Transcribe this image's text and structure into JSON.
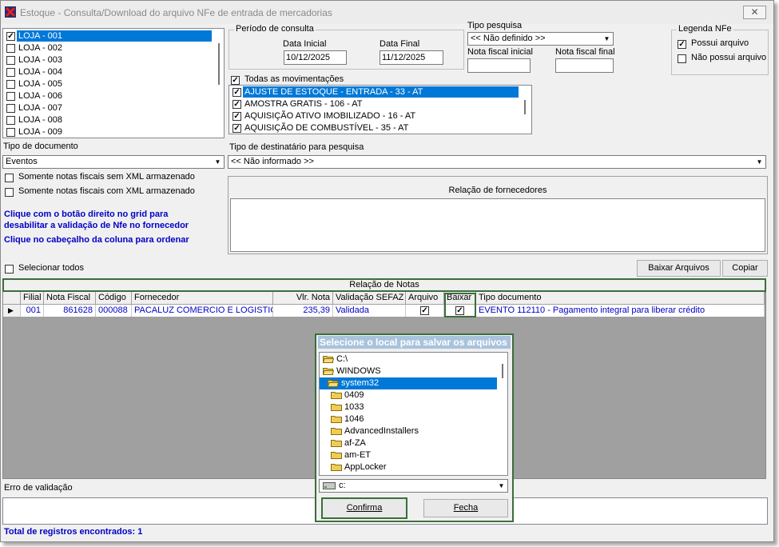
{
  "window": {
    "title": "Estoque - Consulta/Download do arquivo NFe de entrada de mercadorias",
    "close_label": "✕"
  },
  "stores": {
    "items": [
      {
        "label": "LOJA - 001",
        "checked": true,
        "selected": true
      },
      {
        "label": "LOJA - 002",
        "checked": false
      },
      {
        "label": "LOJA - 003",
        "checked": false
      },
      {
        "label": "LOJA - 004",
        "checked": false
      },
      {
        "label": "LOJA - 005",
        "checked": false
      },
      {
        "label": "LOJA - 006",
        "checked": false
      },
      {
        "label": "LOJA - 007",
        "checked": false
      },
      {
        "label": "LOJA - 008",
        "checked": false
      },
      {
        "label": "LOJA - 009",
        "checked": false
      }
    ]
  },
  "period": {
    "group_label": "Período de consulta",
    "start_label": "Data Inicial",
    "start_value": "10/12/2025",
    "end_label": "Data Final",
    "end_value": "11/12/2025"
  },
  "search_type": {
    "label": "Tipo pesquisa",
    "value": "<< Não definido >>"
  },
  "invoice_range": {
    "start_label": "Nota fiscal inicial",
    "end_label": "Nota fiscal final"
  },
  "legend": {
    "group_label": "Legenda NFe",
    "has_file": "Possui arquivo",
    "no_file": "Não possui arquivo"
  },
  "movements": {
    "all_label": "Todas as movimentações",
    "items": [
      {
        "label": "AJUSTE DE ESTOQUE - ENTRADA - 33 - AT",
        "selected": true
      },
      {
        "label": "AMOSTRA GRATIS - 106 - AT"
      },
      {
        "label": "AQUISIÇÃO ATIVO IMOBILIZADO - 16 - AT"
      },
      {
        "label": "AQUISIÇÃO DE COMBUSTÍVEL - 35 - AT"
      }
    ]
  },
  "doc_type": {
    "label": "Tipo de documento",
    "value": "Eventos"
  },
  "recipient_type": {
    "label": "Tipo de destinatário para pesquisa",
    "value": "<< Não informado >>"
  },
  "filters": {
    "without_xml": "Somente notas fiscais sem XML armazenado",
    "with_xml": "Somente notas fiscais com XML armazenado"
  },
  "hints": {
    "line1": "Clique com o botão direito no grid para",
    "line2": "desabilitar a validação de Nfe no fornecedor",
    "line3": "Clique no cabeçalho da coluna para ordenar"
  },
  "suppliers": {
    "header": "Relação de fornecedores"
  },
  "select_all_label": "Selecionar todos",
  "buttons": {
    "download": "Baixar Arquivos",
    "copy": "Copiar"
  },
  "notes": {
    "header": "Relação de Notas",
    "columns": [
      "Filial",
      "Nota Fiscal",
      "Código",
      "Fornecedor",
      "Vlr. Nota",
      "Validação SEFAZ",
      "Arquivo",
      "Baixar",
      "Tipo documento"
    ],
    "rows": [
      {
        "filial": "001",
        "nota": "861628",
        "codigo": "000088",
        "fornecedor": "PACALUZ COMERCIO E LOGISTIC",
        "valor": "235,39",
        "validacao": "Validada",
        "arquivo": true,
        "baixar": true,
        "tipo": "EVENTO 112110 - Pagamento integral para liberar crédito"
      }
    ]
  },
  "dialog": {
    "title": "Selecione o local para salvar os arquivos",
    "tree": [
      {
        "label": "C:\\",
        "level": 0,
        "open": true
      },
      {
        "label": "WINDOWS",
        "level": 1,
        "open": true
      },
      {
        "label": "system32",
        "level": 2,
        "open": true,
        "selected": true
      },
      {
        "label": "0409",
        "level": 3
      },
      {
        "label": "1033",
        "level": 3
      },
      {
        "label": "1046",
        "level": 3
      },
      {
        "label": "AdvancedInstallers",
        "level": 3
      },
      {
        "label": "af-ZA",
        "level": 3
      },
      {
        "label": "am-ET",
        "level": 3
      },
      {
        "label": "AppLocker",
        "level": 3
      }
    ],
    "drive": "c:",
    "confirm": "Confirma",
    "close": "Fecha"
  },
  "validation_error_label": "Erro de validação",
  "total_label": "Total de registros encontrados: 1"
}
